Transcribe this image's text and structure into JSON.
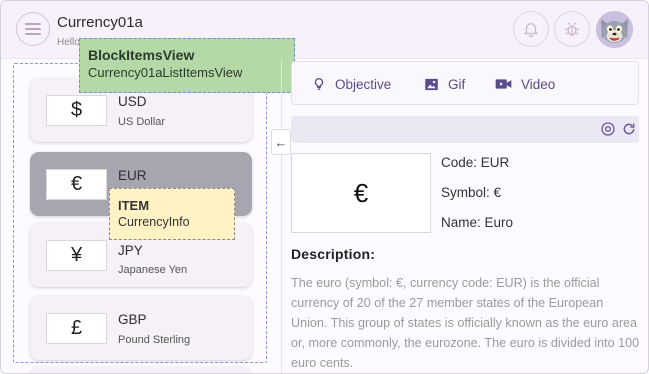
{
  "header": {
    "title": "Currency01a",
    "subtitle": "Hello",
    "icons": [
      "menu-icon",
      "bell-icon",
      "bug-icon"
    ]
  },
  "labels": {
    "block": {
      "title": "BlockItemsView",
      "subtitle": "Currency01aListItemsView"
    },
    "item": {
      "title": "ITEM",
      "subtitle": "CurrencyInfo"
    }
  },
  "currencies": [
    {
      "symbol": "$",
      "code": "USD",
      "name": "US Dollar"
    },
    {
      "symbol": "€",
      "code": "EUR",
      "name": ""
    },
    {
      "symbol": "¥",
      "code": "JPY",
      "name": "Japanese Yen"
    },
    {
      "symbol": "£",
      "code": "GBP",
      "name": "Pound Sterling"
    }
  ],
  "tabs": [
    {
      "label": "Objective",
      "icon": "lightbulb-icon"
    },
    {
      "label": "Gif",
      "icon": "image-icon"
    },
    {
      "label": "Video",
      "icon": "video-icon"
    }
  ],
  "toolbar": {
    "icons": [
      "settings-circle-icon",
      "refresh-icon"
    ]
  },
  "collapse": {
    "glyph": "←"
  },
  "detail": {
    "symbol": "€",
    "code": "Code: EUR",
    "symbol_line": "Symbol: €",
    "name_line": "Name: Euro",
    "description_title": "Description:",
    "description": "The euro (symbol: €, currency code: EUR) is the official currency of 20 of the 27 member states of the European Union. This group of states is officially known as the euro area or, more commonly, the eurozone. The euro is divided into 100 euro cents."
  },
  "colors": {
    "accent": "#5a4a8a",
    "selected_card": "#a7a5af",
    "block_label": "#b5d8a7",
    "item_label": "#fff2c4"
  }
}
